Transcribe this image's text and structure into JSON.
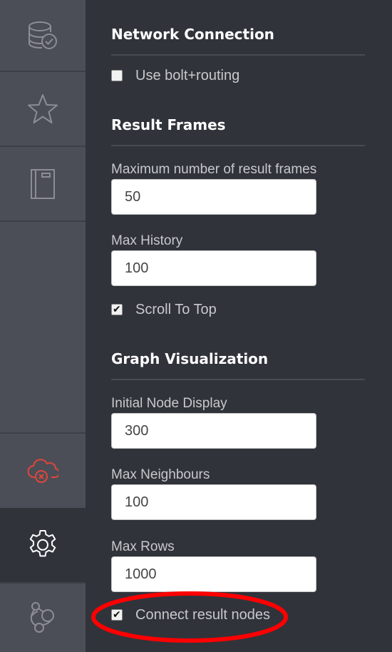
{
  "sidebar": {
    "items": [
      {
        "name": "database",
        "icon": "database-check-icon"
      },
      {
        "name": "favorites",
        "icon": "star-icon"
      },
      {
        "name": "documents",
        "icon": "book-icon"
      },
      {
        "name": "cloud-status",
        "icon": "cloud-disconnected-icon"
      },
      {
        "name": "settings",
        "icon": "gear-icon",
        "active": true
      },
      {
        "name": "about",
        "icon": "neo4j-graph-icon"
      }
    ],
    "colors": {
      "background": "#4c4e57",
      "icon": "#8c8e94",
      "active_icon": "#ffffff",
      "error": "#e0463b"
    }
  },
  "sections": {
    "network": {
      "title": "Network Connection",
      "bolt_routing": {
        "label": "Use bolt+routing",
        "checked": false
      }
    },
    "result_frames": {
      "title": "Result Frames",
      "max_frames": {
        "label": "Maximum number of result frames",
        "value": "50"
      },
      "max_history": {
        "label": "Max History",
        "value": "100"
      },
      "scroll_to_top": {
        "label": "Scroll To Top",
        "checked": true
      }
    },
    "graph_viz": {
      "title": "Graph Visualization",
      "initial_node_display": {
        "label": "Initial Node Display",
        "value": "300"
      },
      "max_neighbours": {
        "label": "Max Neighbours",
        "value": "100"
      },
      "max_rows": {
        "label": "Max Rows",
        "value": "1000"
      },
      "connect_result_nodes": {
        "label": "Connect result nodes",
        "checked": true
      }
    }
  },
  "annotation": {
    "color": "#ff0000",
    "shape": "ellipse",
    "target": "connect-result-nodes"
  }
}
